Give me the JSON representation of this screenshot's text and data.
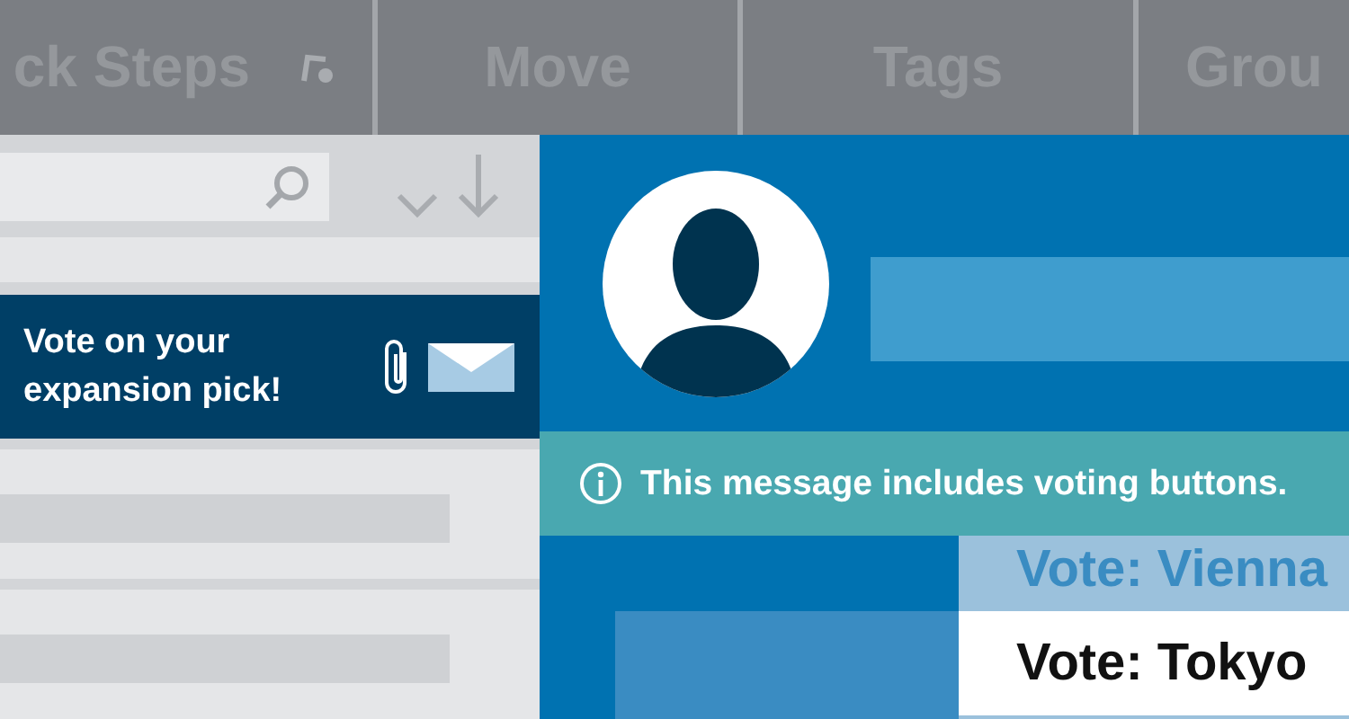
{
  "ribbon": {
    "groups": [
      {
        "label": "ck Steps",
        "launcher": true
      },
      {
        "label": "Move",
        "launcher": false
      },
      {
        "label": "Tags",
        "launcher": false
      },
      {
        "label": "Grou",
        "launcher": false
      }
    ]
  },
  "message_list": {
    "items": [
      {
        "subject": "Vote on your expansion pick!",
        "selected": true,
        "attachment": true
      }
    ]
  },
  "reading_pane": {
    "info_bar": "This message includes voting buttons.",
    "vote_buttons": [
      {
        "label": "Vote: Vienna",
        "selected": false
      },
      {
        "label": "Vote: Tokyo",
        "selected": true
      }
    ]
  }
}
